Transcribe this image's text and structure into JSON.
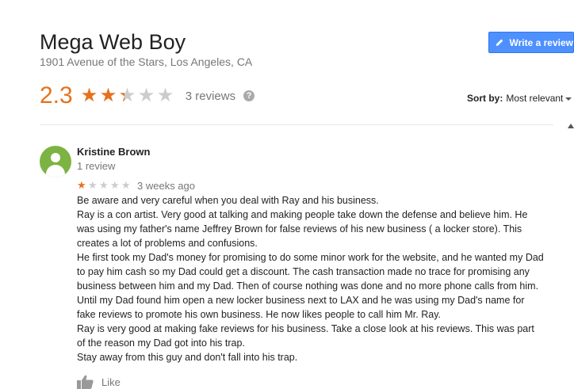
{
  "business": {
    "name": "Mega Web Boy",
    "address": "1901 Avenue of the Stars, Los Angeles, CA"
  },
  "write_review": {
    "label": "Write a review",
    "icon": "pencil-icon"
  },
  "rating": {
    "score": "2.3",
    "stars_value": 2.3,
    "stars_max": 5,
    "review_count": "3 reviews",
    "help_icon": "question-icon"
  },
  "sort": {
    "label": "Sort by:",
    "value": "Most relevant"
  },
  "colors": {
    "accent": "#e7711b",
    "button": "#4d90fe",
    "avatar": "#7cb342"
  },
  "review": {
    "author": "Kristine Brown",
    "author_meta": "1 review",
    "stars_value": 1,
    "date": "3 weeks ago",
    "lines": [
      "Be aware and very careful when you deal with Ray and his business.",
      "Ray is a con artist.  Very good at talking and making people take down the defense and believe him.  He was using my father's name Jeffrey Brown for false reviews of his new business ( a locker store).   This creates a lot of problems and confusions.",
      "He first took my Dad's money for promising to do some minor work for the website, and he wanted my Dad to pay him cash so my Dad could get a discount.  The cash transaction made no trace for promising any business between him and my Dad. Then of course nothing was done and no more phone calls from him.  Until my Dad found him open a new locker business next to LAX and he was using my Dad's name for fake reviews to promote his own business.  He now likes people to call him Mr. Ray.",
      "Ray is very good at making fake reviews for his business. Take a close look at his reviews.  This was part of the reason my Dad got into his trap.",
      "Stay away from this guy and don't fall into his trap."
    ],
    "like_label": "Like"
  }
}
